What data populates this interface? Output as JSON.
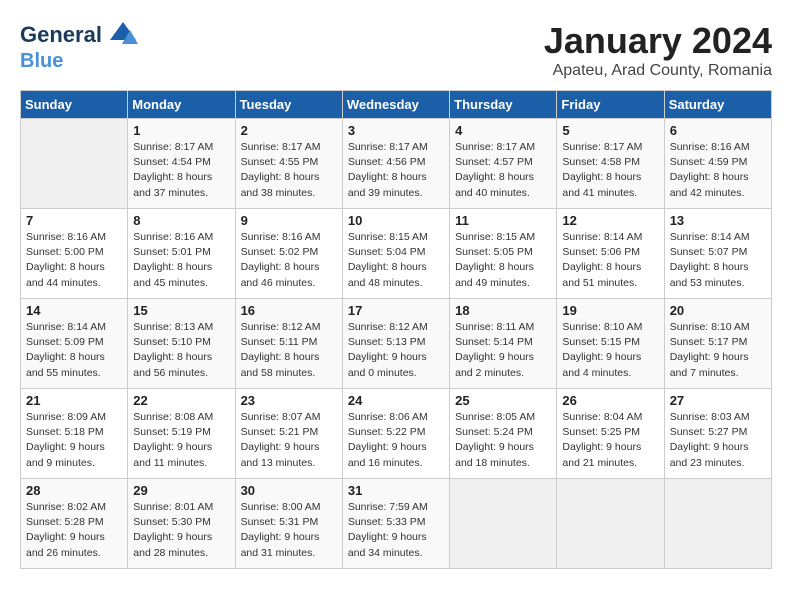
{
  "header": {
    "logo_line1": "General",
    "logo_line2": "Blue",
    "title": "January 2024",
    "subtitle": "Apateu, Arad County, Romania"
  },
  "days_of_week": [
    "Sunday",
    "Monday",
    "Tuesday",
    "Wednesday",
    "Thursday",
    "Friday",
    "Saturday"
  ],
  "weeks": [
    [
      {
        "day": "",
        "info": ""
      },
      {
        "day": "1",
        "info": "Sunrise: 8:17 AM\nSunset: 4:54 PM\nDaylight: 8 hours\nand 37 minutes."
      },
      {
        "day": "2",
        "info": "Sunrise: 8:17 AM\nSunset: 4:55 PM\nDaylight: 8 hours\nand 38 minutes."
      },
      {
        "day": "3",
        "info": "Sunrise: 8:17 AM\nSunset: 4:56 PM\nDaylight: 8 hours\nand 39 minutes."
      },
      {
        "day": "4",
        "info": "Sunrise: 8:17 AM\nSunset: 4:57 PM\nDaylight: 8 hours\nand 40 minutes."
      },
      {
        "day": "5",
        "info": "Sunrise: 8:17 AM\nSunset: 4:58 PM\nDaylight: 8 hours\nand 41 minutes."
      },
      {
        "day": "6",
        "info": "Sunrise: 8:16 AM\nSunset: 4:59 PM\nDaylight: 8 hours\nand 42 minutes."
      }
    ],
    [
      {
        "day": "7",
        "info": "Sunrise: 8:16 AM\nSunset: 5:00 PM\nDaylight: 8 hours\nand 44 minutes."
      },
      {
        "day": "8",
        "info": "Sunrise: 8:16 AM\nSunset: 5:01 PM\nDaylight: 8 hours\nand 45 minutes."
      },
      {
        "day": "9",
        "info": "Sunrise: 8:16 AM\nSunset: 5:02 PM\nDaylight: 8 hours\nand 46 minutes."
      },
      {
        "day": "10",
        "info": "Sunrise: 8:15 AM\nSunset: 5:04 PM\nDaylight: 8 hours\nand 48 minutes."
      },
      {
        "day": "11",
        "info": "Sunrise: 8:15 AM\nSunset: 5:05 PM\nDaylight: 8 hours\nand 49 minutes."
      },
      {
        "day": "12",
        "info": "Sunrise: 8:14 AM\nSunset: 5:06 PM\nDaylight: 8 hours\nand 51 minutes."
      },
      {
        "day": "13",
        "info": "Sunrise: 8:14 AM\nSunset: 5:07 PM\nDaylight: 8 hours\nand 53 minutes."
      }
    ],
    [
      {
        "day": "14",
        "info": "Sunrise: 8:14 AM\nSunset: 5:09 PM\nDaylight: 8 hours\nand 55 minutes."
      },
      {
        "day": "15",
        "info": "Sunrise: 8:13 AM\nSunset: 5:10 PM\nDaylight: 8 hours\nand 56 minutes."
      },
      {
        "day": "16",
        "info": "Sunrise: 8:12 AM\nSunset: 5:11 PM\nDaylight: 8 hours\nand 58 minutes."
      },
      {
        "day": "17",
        "info": "Sunrise: 8:12 AM\nSunset: 5:13 PM\nDaylight: 9 hours\nand 0 minutes."
      },
      {
        "day": "18",
        "info": "Sunrise: 8:11 AM\nSunset: 5:14 PM\nDaylight: 9 hours\nand 2 minutes."
      },
      {
        "day": "19",
        "info": "Sunrise: 8:10 AM\nSunset: 5:15 PM\nDaylight: 9 hours\nand 4 minutes."
      },
      {
        "day": "20",
        "info": "Sunrise: 8:10 AM\nSunset: 5:17 PM\nDaylight: 9 hours\nand 7 minutes."
      }
    ],
    [
      {
        "day": "21",
        "info": "Sunrise: 8:09 AM\nSunset: 5:18 PM\nDaylight: 9 hours\nand 9 minutes."
      },
      {
        "day": "22",
        "info": "Sunrise: 8:08 AM\nSunset: 5:19 PM\nDaylight: 9 hours\nand 11 minutes."
      },
      {
        "day": "23",
        "info": "Sunrise: 8:07 AM\nSunset: 5:21 PM\nDaylight: 9 hours\nand 13 minutes."
      },
      {
        "day": "24",
        "info": "Sunrise: 8:06 AM\nSunset: 5:22 PM\nDaylight: 9 hours\nand 16 minutes."
      },
      {
        "day": "25",
        "info": "Sunrise: 8:05 AM\nSunset: 5:24 PM\nDaylight: 9 hours\nand 18 minutes."
      },
      {
        "day": "26",
        "info": "Sunrise: 8:04 AM\nSunset: 5:25 PM\nDaylight: 9 hours\nand 21 minutes."
      },
      {
        "day": "27",
        "info": "Sunrise: 8:03 AM\nSunset: 5:27 PM\nDaylight: 9 hours\nand 23 minutes."
      }
    ],
    [
      {
        "day": "28",
        "info": "Sunrise: 8:02 AM\nSunset: 5:28 PM\nDaylight: 9 hours\nand 26 minutes."
      },
      {
        "day": "29",
        "info": "Sunrise: 8:01 AM\nSunset: 5:30 PM\nDaylight: 9 hours\nand 28 minutes."
      },
      {
        "day": "30",
        "info": "Sunrise: 8:00 AM\nSunset: 5:31 PM\nDaylight: 9 hours\nand 31 minutes."
      },
      {
        "day": "31",
        "info": "Sunrise: 7:59 AM\nSunset: 5:33 PM\nDaylight: 9 hours\nand 34 minutes."
      },
      {
        "day": "",
        "info": ""
      },
      {
        "day": "",
        "info": ""
      },
      {
        "day": "",
        "info": ""
      }
    ]
  ]
}
